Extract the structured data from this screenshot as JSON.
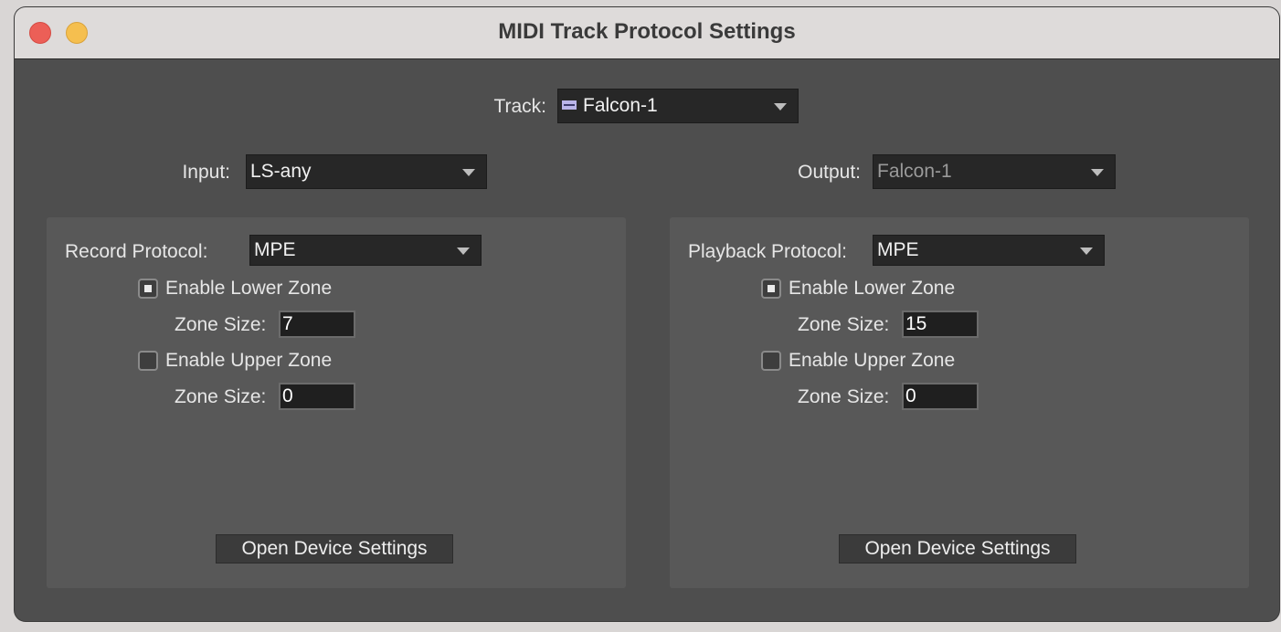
{
  "window": {
    "title": "MIDI Track Protocol Settings"
  },
  "track": {
    "label": "Track:",
    "value": "Falcon-1",
    "icon": "midi-track-icon"
  },
  "input": {
    "label": "Input:",
    "value": "LS-any"
  },
  "output": {
    "label": "Output:",
    "value": "Falcon-1",
    "disabled": true
  },
  "record": {
    "protocol_label": "Record Protocol:",
    "protocol_value": "MPE",
    "lower_zone": {
      "label": "Enable Lower Zone",
      "checked": true,
      "size_label": "Zone Size:",
      "size_value": "7"
    },
    "upper_zone": {
      "label": "Enable Upper Zone",
      "checked": false,
      "size_label": "Zone Size:",
      "size_value": "0"
    },
    "device_button": "Open Device Settings"
  },
  "playback": {
    "protocol_label": "Playback Protocol:",
    "protocol_value": "MPE",
    "lower_zone": {
      "label": "Enable Lower Zone",
      "checked": true,
      "size_label": "Zone Size:",
      "size_value": "15"
    },
    "upper_zone": {
      "label": "Enable Upper Zone",
      "checked": false,
      "size_label": "Zone Size:",
      "size_value": "0"
    },
    "device_button": "Open Device Settings"
  },
  "colors": {
    "window_bg": "#4e4e4e",
    "panel_bg": "#585858",
    "titlebar_bg": "#dedbda",
    "close": "#ec5f57",
    "minimize": "#f5bf4f"
  }
}
